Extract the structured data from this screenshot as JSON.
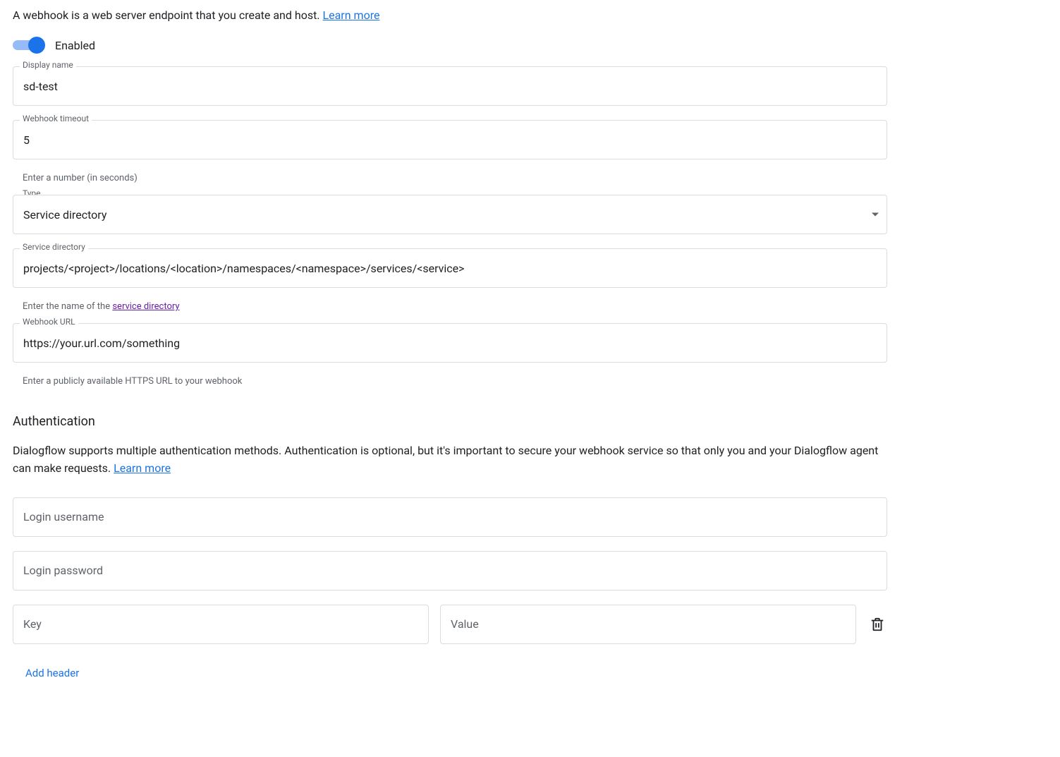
{
  "intro": {
    "text": "A webhook is a web server endpoint that you create and host. ",
    "learnMore": "Learn more"
  },
  "enabled": {
    "label": "Enabled",
    "value": true
  },
  "displayName": {
    "label": "Display name",
    "value": "sd-test"
  },
  "timeout": {
    "label": "Webhook timeout",
    "value": "5",
    "helper": "Enter a number (in seconds)"
  },
  "type": {
    "label": "Type",
    "value": "Service directory"
  },
  "serviceDirectory": {
    "label": "Service directory",
    "value": "projects/<project>/locations/<location>/namespaces/<namespace>/services/<service>",
    "helperPrefix": "Enter the name of the ",
    "helperLink": "service directory"
  },
  "webhookUrl": {
    "label": "Webhook URL",
    "value": "https://your.url.com/something",
    "helper": "Enter a publicly available HTTPS URL to your webhook"
  },
  "auth": {
    "title": "Authentication",
    "desc": "Dialogflow supports multiple authentication methods. Authentication is optional, but it's important to secure your webhook service so that only you and your Dialogflow agent can make requests. ",
    "learnMore": "Learn more",
    "usernamePlaceholder": "Login username",
    "usernameValue": "",
    "passwordPlaceholder": "Login password",
    "passwordValue": "",
    "headers": [
      {
        "key": "",
        "value": ""
      }
    ],
    "keyPlaceholder": "Key",
    "valuePlaceholder": "Value",
    "addHeader": "Add header"
  }
}
